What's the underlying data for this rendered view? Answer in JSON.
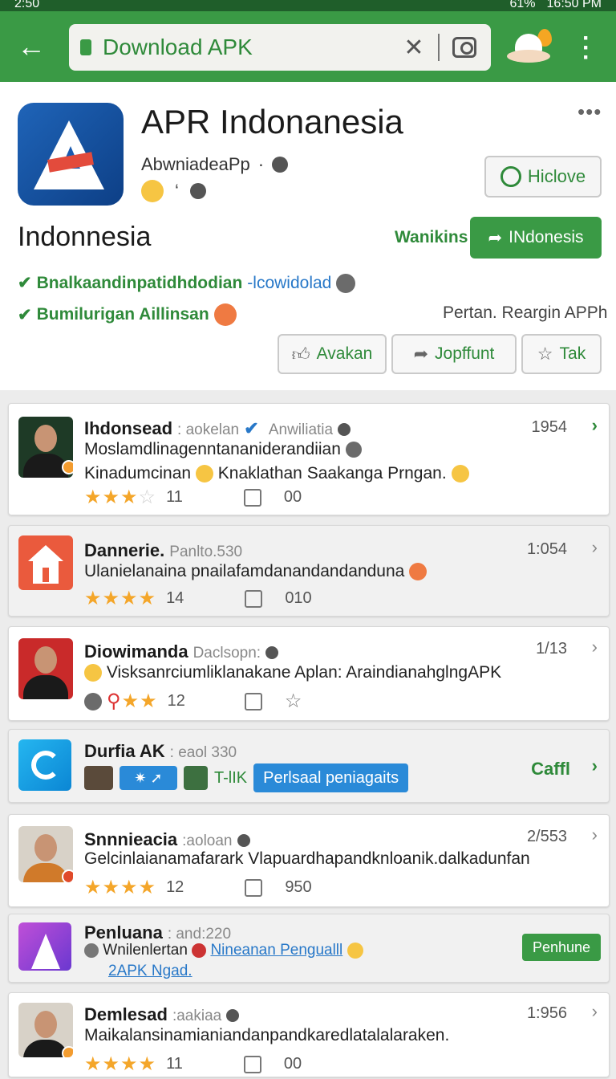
{
  "status_bar": {
    "left": "2:50",
    "battery": "61%",
    "time": "16:50 PM"
  },
  "appbar": {
    "url": "Download APK"
  },
  "header": {
    "app_name": "APR Indonanesia",
    "developer": "AbwniadeaPp",
    "follow_label": "Hiclove",
    "country": "Indonnesia",
    "wanikins_label": "Wanikins",
    "install_label": "INdonesis",
    "feature1_green": "Bnalkaandinpatidhdodian",
    "feature1_blue": "-lcowidolad",
    "feature2": "Bumilurigan Aillinsan",
    "report_label": "Pertan. Reargin APPh",
    "pills": [
      "Avakan",
      "Jopffunt",
      "Tak"
    ]
  },
  "items": [
    {
      "name": "Ihdonsead",
      "sub": ": aokelan",
      "verified_label": "Anwiliatia",
      "line1": "Moslamdlinagenntananiderandiian",
      "line2a": "Kinadumcinan",
      "line2b": "Knaklathan Saakanga Prngan.",
      "num": "1954",
      "rating_count": "11",
      "likes": "00"
    },
    {
      "name": "Dannerie.",
      "sub": "Panlto.530",
      "line1": "Ulanielanaina pnailafamdanandandanduna",
      "num": "1:054",
      "rating_count": "14",
      "likes": "010"
    },
    {
      "name": "Diowimanda",
      "sub": "Daclsopn:",
      "line1": "Visksanrciumliklanakane Aplan: AraindianahglngAPK",
      "num": "1/13",
      "rating_count": "12"
    },
    {
      "name": "Durfia AK",
      "sub": ": eaol 330",
      "chip_text": "T-lIK",
      "button": "Perlsaal peniagaits",
      "action": "Caffl"
    },
    {
      "name": "Snnnieacia",
      "sub": ":aoloan",
      "line1": "Gelcinlaianamafarark Vlapuardhapandknloanik.dalkadunfan",
      "num": "2/553",
      "rating_count": "12",
      "likes": "950"
    },
    {
      "name": "Penluana",
      "sub": ": and:220",
      "line1a": "Wnilenlertan",
      "line1_link": "Nineanan Pengualll",
      "line2_link": "2APK Ngad.",
      "button": "Penhune"
    },
    {
      "name": "Demlesad",
      "sub": ":aakiaa",
      "line1": "Maikalansinamianiandanpandkaredlatalalaraken.",
      "num": "1:956",
      "rating_count": "11",
      "likes": "00"
    }
  ]
}
